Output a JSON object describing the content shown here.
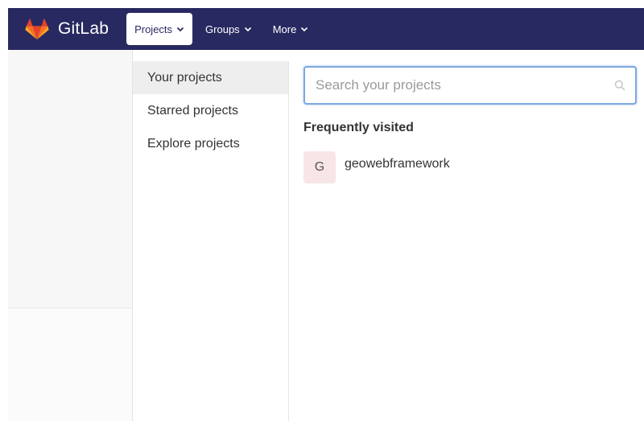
{
  "navbar": {
    "brand": "GitLab",
    "logo_icon": "tanuki-logo-icon",
    "items": [
      {
        "label": "Projects",
        "active": true
      },
      {
        "label": "Groups",
        "active": false
      },
      {
        "label": "More",
        "active": false
      }
    ]
  },
  "dropdown": {
    "menu": [
      {
        "label": "Your projects",
        "active": true
      },
      {
        "label": "Starred projects",
        "active": false
      },
      {
        "label": "Explore projects",
        "active": false
      }
    ],
    "search": {
      "placeholder": "Search your projects",
      "value": ""
    },
    "section_title": "Frequently visited",
    "projects": [
      {
        "initial": "G",
        "name": "geowebframework"
      }
    ]
  },
  "colors": {
    "navbar_bg": "#292961",
    "search_border": "#7aa9e0",
    "avatar_bg": "#f8e6e6"
  }
}
